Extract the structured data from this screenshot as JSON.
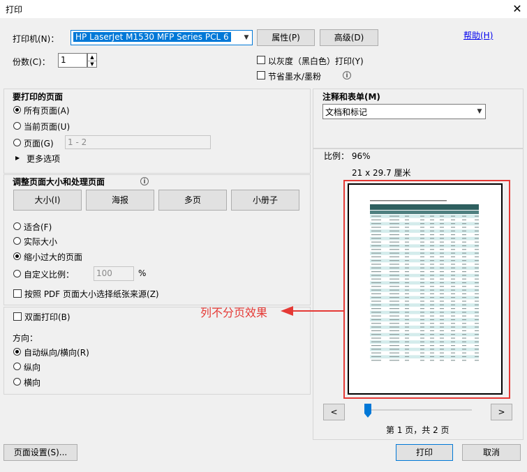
{
  "window": {
    "title": "打印",
    "close_glyph": "✕"
  },
  "printer": {
    "label": "打印机(N)：",
    "selected": "HP LaserJet M1530 MFP Series PCL 6",
    "properties_btn": "属性(P)",
    "advanced_btn": "高级(D)",
    "help_link": "帮助(H)",
    "copies_label": "份数(C)：",
    "copies_value": "1",
    "grayscale_label": "以灰度（黑白色）打印(Y)",
    "save_ink_label": "节省墨水/墨粉"
  },
  "pages_to_print": {
    "heading": "要打印的页面",
    "all_pages": "所有页面(A)",
    "current_page": "当前页面(U)",
    "pages": "页面(G)",
    "pages_value": "1 - 2",
    "more_options": "更多选项"
  },
  "sizing": {
    "heading": "调整页面大小和处理页面",
    "tabs": [
      "大小(I)",
      "海报",
      "多页",
      "小册子"
    ],
    "fit": "适合(F)",
    "actual_size": "实际大小",
    "shrink": "缩小过大的页面",
    "custom_scale": "自定义比例：",
    "custom_scale_value": "100",
    "percent": "%",
    "paper_source": "按照 PDF 页面大小选择纸张来源(Z)"
  },
  "duplex": {
    "label": "双面打印(B)",
    "orientation_label": "方向：",
    "auto": "自动纵向/横向(R)",
    "portrait": "纵向",
    "landscape": "横向"
  },
  "comments": {
    "heading": "注释和表单(M)",
    "selected": "文档和标记"
  },
  "preview": {
    "scale": "比例： 96%",
    "paper_size": "21 x 29.7 厘米",
    "prev": "<",
    "next": ">",
    "page_info": "第 1 页，共 2 页",
    "slider_level": 0.0,
    "annotation": "列不分页效果"
  },
  "footer": {
    "page_setup": "页面设置(S)...",
    "print": "打印",
    "cancel": "取消"
  },
  "colors": {
    "accent": "#0078d7",
    "annotation_red": "#e53935",
    "table_header": "#2e5f5f",
    "table_stripe": "#d4ecec"
  }
}
